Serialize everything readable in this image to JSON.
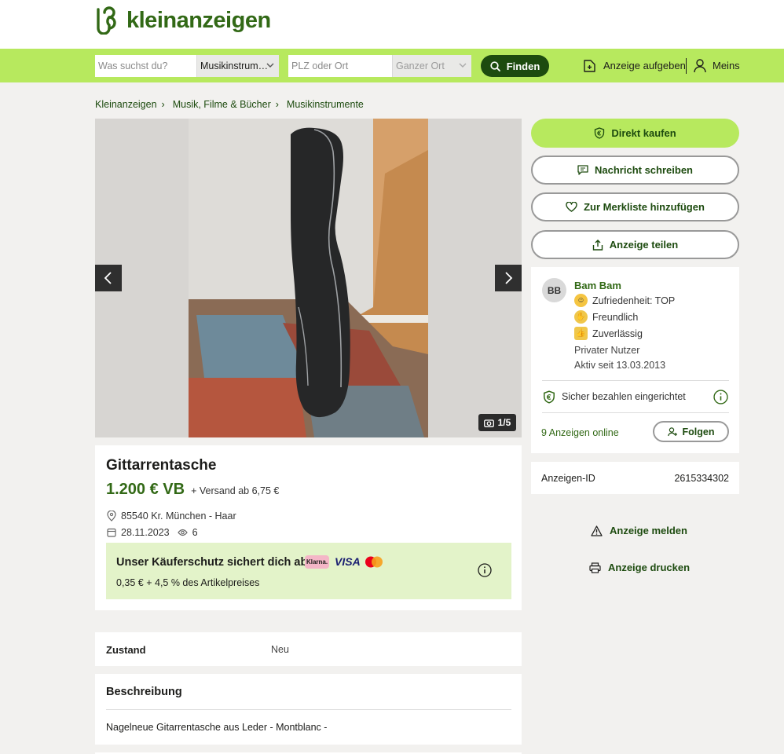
{
  "header": {
    "logo_text": "kleinanzeigen"
  },
  "search": {
    "query_placeholder": "Was suchst du?",
    "category_value": "Musikinstrum…",
    "location_placeholder": "PLZ oder Ort",
    "radius_value": "Ganzer Ort",
    "find_label": "Finden",
    "post_ad_label": "Anzeige aufgeben",
    "account_label": "Meins"
  },
  "breadcrumb": [
    "Kleinanzeigen",
    "Musik, Filme & Bücher",
    "Musikinstrumente"
  ],
  "gallery": {
    "counter": "1/5"
  },
  "listing": {
    "title": "Gittarrentasche",
    "price": "1.200 € VB",
    "shipping": "+ Versand ab 6,75 €",
    "location": "85540 Kr. München - Haar",
    "date": "28.11.2023",
    "views": "6"
  },
  "protection": {
    "title": "Unser Käuferschutz sichert dich ab",
    "fee": "0,35 € + 4,5 % des Artikelpreises",
    "klarna_label": "Klarna.",
    "visa_label": "VISA"
  },
  "details": {
    "condition_label": "Zustand",
    "condition_value": "Neu"
  },
  "description": {
    "heading": "Beschreibung",
    "text": "Nagelneue Gitarrentasche aus Leder - Montblanc -"
  },
  "actions": {
    "buy_now": "Direkt kaufen",
    "message": "Nachricht schreiben",
    "watchlist": "Zur Merkliste hinzufügen",
    "share": "Anzeige teilen"
  },
  "seller": {
    "initials": "BB",
    "name": "Bam Bam",
    "badges": [
      "Zufriedenheit: TOP",
      "Freundlich",
      "Zuverlässig"
    ],
    "type": "Privater Nutzer",
    "active_since": "Aktiv seit 13.03.2013",
    "secure_pay": "Sicher bezahlen eingerichtet",
    "ads_online": "9 Anzeigen online",
    "follow_label": "Folgen"
  },
  "ad_id": {
    "label": "Anzeigen-ID",
    "value": "2615334302"
  },
  "links": {
    "report": "Anzeige melden",
    "print": "Anzeige drucken"
  },
  "colors": {
    "brand_green": "#326916",
    "accent_lime": "#b7e95e",
    "dark_green": "#1d4b0f"
  }
}
